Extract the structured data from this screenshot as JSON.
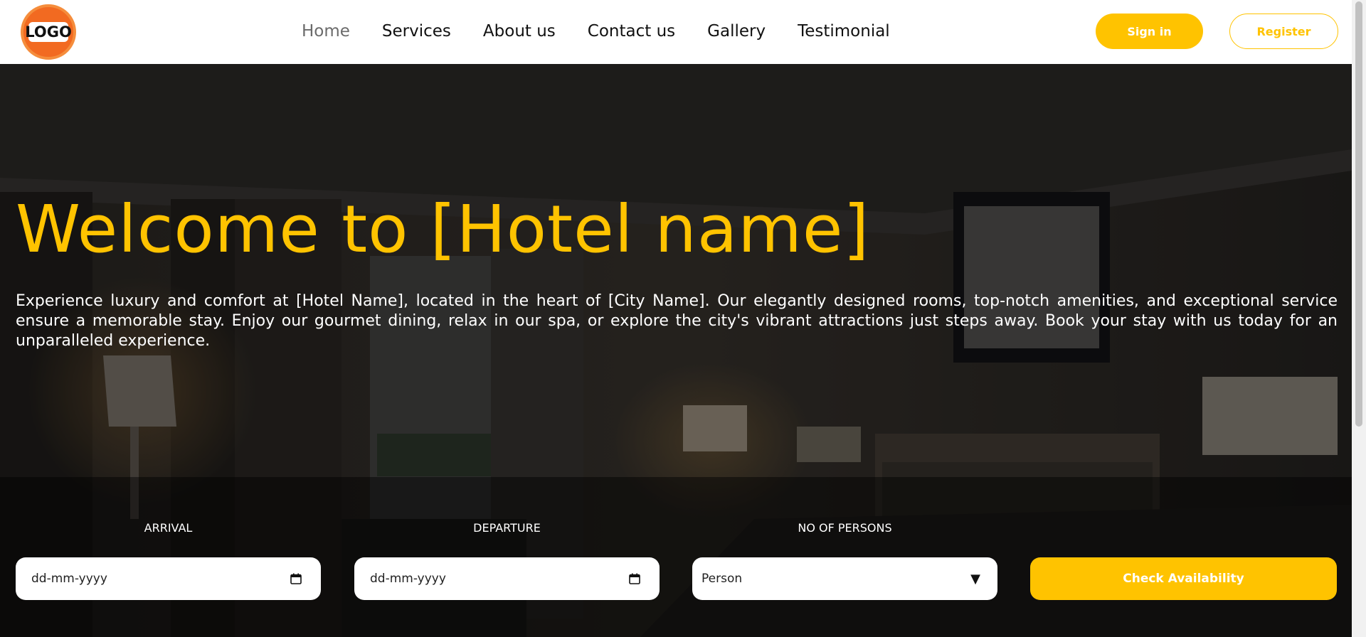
{
  "logo": {
    "text": "LOGO"
  },
  "nav": {
    "links": [
      {
        "label": "Home",
        "active": true
      },
      {
        "label": "Services"
      },
      {
        "label": "About us"
      },
      {
        "label": "Contact us"
      },
      {
        "label": "Gallery"
      },
      {
        "label": "Testimonial"
      }
    ],
    "signin_label": "Sign in",
    "register_label": "Register"
  },
  "hero": {
    "title": "Welcome to [Hotel name]",
    "description": "Experience luxury and comfort at [Hotel Name], located in the heart of [City Name]. Our elegantly designed rooms, top-notch amenities, and exceptional service ensure a memorable stay. Enjoy our gourmet dining, relax in our spa, or explore the city's vibrant attractions just steps away. Book your stay with us today for an unparalleled experience."
  },
  "booking": {
    "arrival": {
      "label": "ARRIVAL",
      "value": "dd-mm-yyyy",
      "icon": "calendar-icon"
    },
    "departure": {
      "label": "DEPARTURE",
      "value": "dd-mm-yyyy",
      "icon": "calendar-icon"
    },
    "persons": {
      "label": "NO OF PERSONS",
      "value": "Person",
      "icon": "caret-down-icon"
    },
    "submit_label": "Check Availability"
  },
  "colors": {
    "accent": "#ffc300",
    "logo_orange": "#f26a21",
    "text_dark": "#111111",
    "active_nav": "#6b6b6b"
  }
}
